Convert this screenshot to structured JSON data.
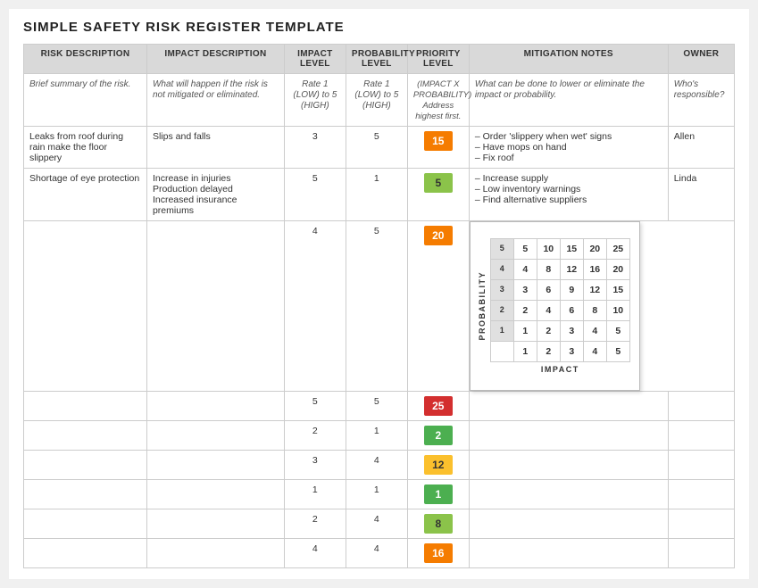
{
  "page": {
    "title": "SIMPLE SAFETY RISK REGISTER TEMPLATE"
  },
  "table": {
    "headers": [
      {
        "id": "risk",
        "label": "RISK DESCRIPTION"
      },
      {
        "id": "impact_desc",
        "label": "IMPACT DESCRIPTION"
      },
      {
        "id": "impact_level",
        "label": "IMPACT LEVEL"
      },
      {
        "id": "prob_level",
        "label": "PROBABILITY LEVEL"
      },
      {
        "id": "priority",
        "label": "PRIORITY LEVEL"
      },
      {
        "id": "mitigation",
        "label": "MITIGATION NOTES"
      },
      {
        "id": "owner",
        "label": "OWNER"
      }
    ],
    "note_row": {
      "risk": "Brief summary of the risk.",
      "impact_desc": "What will happen if the risk is not mitigated or eliminated.",
      "impact_level": "Rate 1 (LOW) to 5 (HIGH)",
      "prob_level": "Rate 1 (LOW) to 5 (HIGH)",
      "priority": "(IMPACT X PROBABILITY) Address highest first.",
      "mitigation": "What can be done to lower or eliminate the impact or probability.",
      "owner": "Who's responsible?"
    },
    "rows": [
      {
        "risk": "Leaks from roof during rain make the floor slippery",
        "impact_desc": "Slips and falls",
        "impact_level": "3",
        "prob_level": "5",
        "priority": "15",
        "priority_color": "orange",
        "mitigation": "– Order 'slippery when wet' signs\n– Have mops on hand\n– Fix roof",
        "owner": "Allen"
      },
      {
        "risk": "Shortage of eye protection",
        "impact_desc": "Increase in injuries\nProduction delayed\nIncreased insurance premiums",
        "impact_level": "5",
        "prob_level": "1",
        "priority": "5",
        "priority_color": "light-green",
        "mitigation": "– Increase supply\n– Low inventory warnings\n– Find alternative suppliers",
        "owner": "Linda"
      },
      {
        "risk": "",
        "impact_desc": "",
        "impact_level": "4",
        "prob_level": "5",
        "priority": "20",
        "priority_color": "orange",
        "mitigation": "",
        "owner": "",
        "has_matrix": true
      },
      {
        "risk": "",
        "impact_desc": "",
        "impact_level": "5",
        "prob_level": "5",
        "priority": "25",
        "priority_color": "red",
        "mitigation": "",
        "owner": ""
      },
      {
        "risk": "",
        "impact_desc": "",
        "impact_level": "2",
        "prob_level": "1",
        "priority": "2",
        "priority_color": "green",
        "mitigation": "",
        "owner": ""
      },
      {
        "risk": "",
        "impact_desc": "",
        "impact_level": "3",
        "prob_level": "4",
        "priority": "12",
        "priority_color": "yellow",
        "mitigation": "",
        "owner": ""
      },
      {
        "risk": "",
        "impact_desc": "",
        "impact_level": "1",
        "prob_level": "1",
        "priority": "1",
        "priority_color": "green",
        "mitigation": "",
        "owner": ""
      },
      {
        "risk": "",
        "impact_desc": "",
        "impact_level": "2",
        "prob_level": "4",
        "priority": "8",
        "priority_color": "light-green",
        "mitigation": "",
        "owner": ""
      },
      {
        "risk": "",
        "impact_desc": "",
        "impact_level": "4",
        "prob_level": "4",
        "priority": "16",
        "priority_color": "orange",
        "mitigation": "",
        "owner": ""
      }
    ]
  },
  "matrix": {
    "title_y": "PROBABILITY",
    "title_x": "IMPACT",
    "rows": [
      {
        "prob": "5",
        "cells": [
          "5",
          "10",
          "15",
          "20",
          "25"
        ],
        "colors": [
          "green",
          "light-green",
          "orange",
          "orange",
          "red"
        ]
      },
      {
        "prob": "4",
        "cells": [
          "4",
          "8",
          "12",
          "16",
          "20"
        ],
        "colors": [
          "green",
          "light-green",
          "yellow",
          "orange",
          "orange"
        ]
      },
      {
        "prob": "3",
        "cells": [
          "3",
          "6",
          "9",
          "12",
          "15"
        ],
        "colors": [
          "green",
          "light-green",
          "light-green",
          "yellow",
          "orange"
        ]
      },
      {
        "prob": "2",
        "cells": [
          "2",
          "4",
          "6",
          "8",
          "10"
        ],
        "colors": [
          "green",
          "green",
          "light-green",
          "light-green",
          "yellow"
        ]
      },
      {
        "prob": "1",
        "cells": [
          "1",
          "2",
          "3",
          "4",
          "5"
        ],
        "colors": [
          "green",
          "green",
          "green",
          "green",
          "light-green"
        ]
      }
    ],
    "impact_headers": [
      "1",
      "2",
      "3",
      "4",
      "5"
    ]
  }
}
